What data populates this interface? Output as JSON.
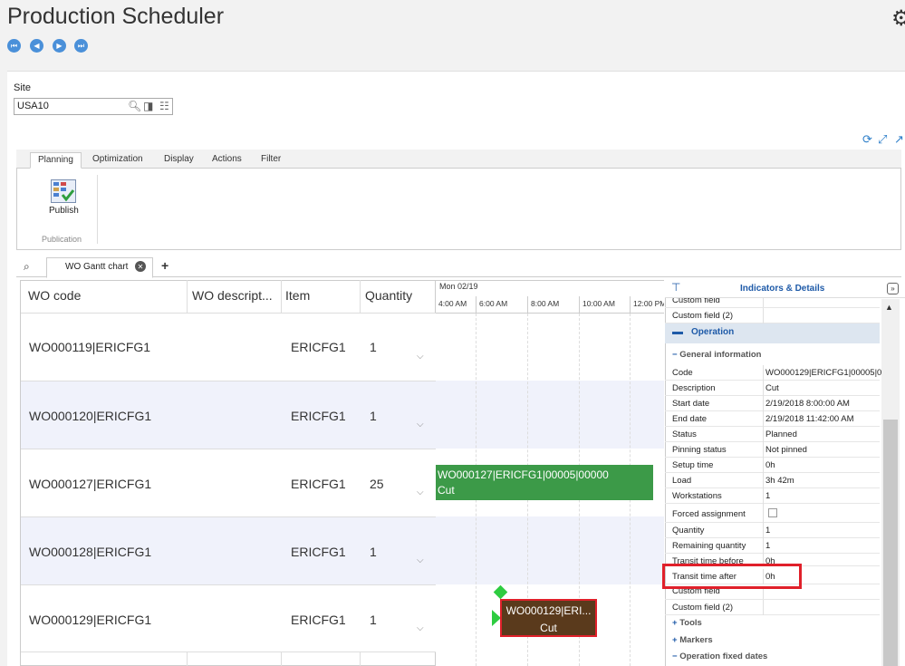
{
  "app": {
    "title": "Production Scheduler"
  },
  "site": {
    "label": "Site",
    "value": "USA10"
  },
  "ribbon": {
    "tabs": [
      "Planning",
      "Optimization",
      "Display",
      "Actions",
      "Filter"
    ],
    "active_tab": "Planning",
    "publish_label": "Publish",
    "group_label": "Publication"
  },
  "doc_tabs": {
    "gantt_label": "WO Gantt chart"
  },
  "grid": {
    "columns": [
      "WO code",
      "WO descript...",
      "Item",
      "Quantity"
    ],
    "rows": [
      {
        "wo": "WO000119|ERICFG1",
        "desc": "",
        "item": "ERICFG1",
        "qty": "1"
      },
      {
        "wo": "WO000120|ERICFG1",
        "desc": "",
        "item": "ERICFG1",
        "qty": "1"
      },
      {
        "wo": "WO000127|ERICFG1",
        "desc": "",
        "item": "ERICFG1",
        "qty": "25"
      },
      {
        "wo": "WO000128|ERICFG1",
        "desc": "",
        "item": "ERICFG1",
        "qty": "1"
      },
      {
        "wo": "WO000129|ERICFG1",
        "desc": "",
        "item": "ERICFG1",
        "qty": "1"
      }
    ]
  },
  "gantt": {
    "date": "Mon 02/19",
    "ticks": [
      "4:00 AM",
      "6:00 AM",
      "8:00 AM",
      "10:00 AM",
      "12:00 PM"
    ],
    "bar127": {
      "line1": "WO000127|ERICFG1|00005|00000",
      "line2": "Cut",
      "color": "#3c9a48"
    },
    "bar129": {
      "line1": "WO000129|ERI...",
      "line2": "Cut",
      "color": "#5a3a1c"
    }
  },
  "details": {
    "title": "Indicators & Details",
    "top_props": [
      {
        "name": "Custom field",
        "value": ""
      },
      {
        "name": "Custom field (2)",
        "value": ""
      }
    ],
    "operation_label": "Operation",
    "general_label": "General information",
    "props": [
      {
        "name": "Code",
        "value": "WO000129|ERICFG1|00005|0"
      },
      {
        "name": "Description",
        "value": "Cut"
      },
      {
        "name": "Start date",
        "value": "2/19/2018 8:00:00 AM"
      },
      {
        "name": "End date",
        "value": "2/19/2018 11:42:00 AM"
      },
      {
        "name": "Status",
        "value": "Planned"
      },
      {
        "name": "Pinning status",
        "value": "Not pinned"
      },
      {
        "name": "Setup time",
        "value": "0h"
      },
      {
        "name": "Load",
        "value": "3h 42m"
      },
      {
        "name": "Workstations",
        "value": "1"
      },
      {
        "name": "Forced assignment",
        "value": ""
      },
      {
        "name": "Quantity",
        "value": "1"
      },
      {
        "name": "Remaining quantity",
        "value": "1"
      },
      {
        "name": "Transit time before",
        "value": "0h"
      },
      {
        "name": "Transit time after",
        "value": "0h"
      },
      {
        "name": "Custom field",
        "value": ""
      },
      {
        "name": "Custom field (2)",
        "value": ""
      }
    ],
    "tools_label": "Tools",
    "markers_label": "Markers",
    "fixed_dates_label": "Operation fixed dates"
  }
}
